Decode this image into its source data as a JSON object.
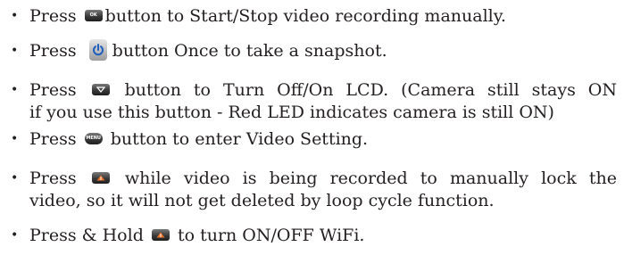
{
  "items": [
    {
      "before": "Press",
      "icon": "ok-button-icon",
      "icon_label": "OK",
      "after": "button to Start/Stop video recording manually."
    },
    {
      "before": "Press",
      "icon": "power-button-icon",
      "after": "button Once to take a snapshot."
    },
    {
      "before": "Press",
      "icon": "down-arrow-button-icon",
      "after": "button to Turn Off/On LCD. (Camera still stays ON",
      "continuation": "if you use this button - Red LED indicates camera is still ON)"
    },
    {
      "before": "Press",
      "icon": "menu-button-icon",
      "icon_label": "MENU",
      "after": "button to enter Video Setting."
    },
    {
      "before": "Press",
      "icon": "up-arrow-button-icon",
      "after": "while video is being recorded to manually lock the",
      "continuation": "video, so it will not get deleted by loop cycle function."
    },
    {
      "before": "Press & Hold",
      "icon": "up-arrow-button-icon",
      "after": "to turn ON/OFF WiFi."
    }
  ],
  "bullet_glyph": "•",
  "colors": {
    "text": "#231f20",
    "button_dark": "#2a2a2a",
    "arrow_orange": "#e8722a",
    "power_blue": "#1f5fbf"
  }
}
